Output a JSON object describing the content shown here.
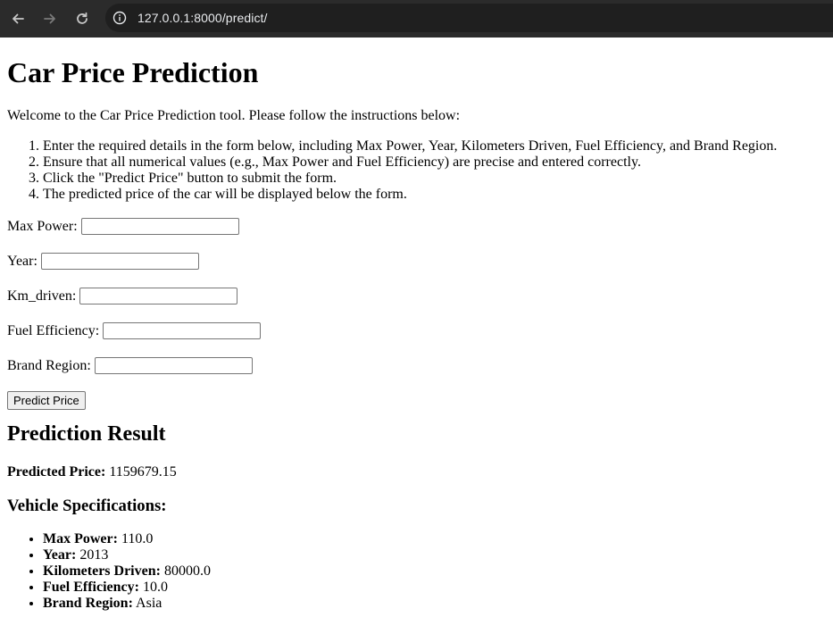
{
  "browser": {
    "url": "127.0.0.1:8000/predict/"
  },
  "page": {
    "title": "Car Price Prediction",
    "intro": "Welcome to the Car Price Prediction tool. Please follow the instructions below:",
    "instructions": [
      "Enter the required details in the form below, including Max Power, Year, Kilometers Driven, Fuel Efficiency, and Brand Region.",
      "Ensure that all numerical values (e.g., Max Power and Fuel Efficiency) are precise and entered correctly.",
      "Click the \"Predict Price\" button to submit the form.",
      "The predicted price of the car will be displayed below the form."
    ]
  },
  "form": {
    "fields": [
      {
        "label": "Max Power:",
        "value": ""
      },
      {
        "label": "Year:",
        "value": ""
      },
      {
        "label": "Km_driven:",
        "value": ""
      },
      {
        "label": "Fuel Efficiency:",
        "value": ""
      },
      {
        "label": "Brand Region:",
        "value": ""
      }
    ],
    "submit_label": "Predict Price"
  },
  "result": {
    "heading": "Prediction Result",
    "price_label": "Predicted Price:",
    "price_value": "1159679.15",
    "specs_heading": "Vehicle Specifications:",
    "specs": [
      {
        "label": "Max Power:",
        "value": "110.0"
      },
      {
        "label": "Year:",
        "value": "2013"
      },
      {
        "label": "Kilometers Driven:",
        "value": "80000.0"
      },
      {
        "label": "Fuel Efficiency:",
        "value": "10.0"
      },
      {
        "label": "Brand Region:",
        "value": "Asia"
      }
    ]
  }
}
